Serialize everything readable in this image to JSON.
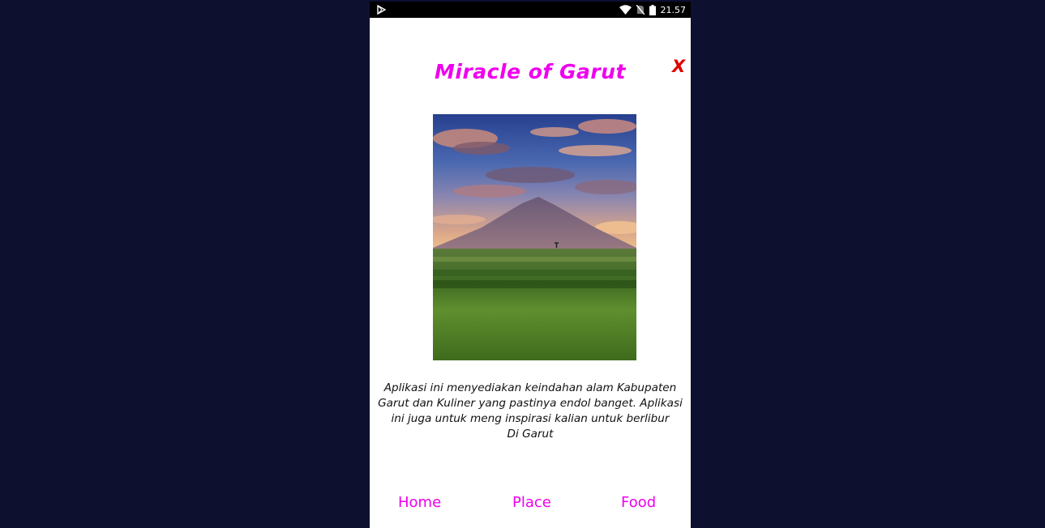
{
  "status_bar": {
    "time": "21.57",
    "icons": [
      "play-store-icon",
      "wifi-icon",
      "no-sim-icon",
      "battery-icon"
    ]
  },
  "header": {
    "title": "Miracle of Garut",
    "close_label": "X"
  },
  "colors": {
    "title": "#ee00ee",
    "close": "#e00000",
    "nav": "#ee00ee",
    "background": "#0e1030"
  },
  "description": " Aplikasi ini menyediakan keindahan alam Kabupaten\nGarut dan Kuliner yang pastinya endol banget. Aplikasi\nini juga untuk meng inspirasi kalian untuk berlibur\nDi Garut",
  "nav": {
    "home": "Home",
    "place": "Place",
    "food": "Food"
  }
}
